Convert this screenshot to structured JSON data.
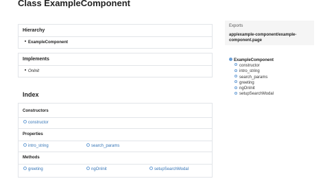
{
  "page": {
    "title": "Class ExampleComponent"
  },
  "hierarchy": {
    "heading": "Hierarchy",
    "items": [
      "ExampleComponent"
    ]
  },
  "implements": {
    "heading": "Implements",
    "items": [
      "OnInit"
    ]
  },
  "index": {
    "title": "Index",
    "constructors": {
      "heading": "Constructors",
      "items": [
        "constructor"
      ]
    },
    "properties": {
      "heading": "Properties",
      "items": [
        "intro_string",
        "search_params"
      ]
    },
    "methods": {
      "heading": "Methods",
      "items": [
        "greeting",
        "ngOnInit",
        "setupSearchModal"
      ]
    }
  },
  "exports": {
    "label": "Exports",
    "path": "app/example-component/example-component.page"
  },
  "toc": {
    "root": "ExampleComponent",
    "items": [
      "constructor",
      "intro_string",
      "search_params",
      "greeting",
      "ngOnInit",
      "setupSearchModal"
    ]
  },
  "colors": {
    "link": "#3474b6",
    "icon": "#6a9fd6",
    "border": "#e1e4e8",
    "exports_bg": "#f5f5f5"
  }
}
